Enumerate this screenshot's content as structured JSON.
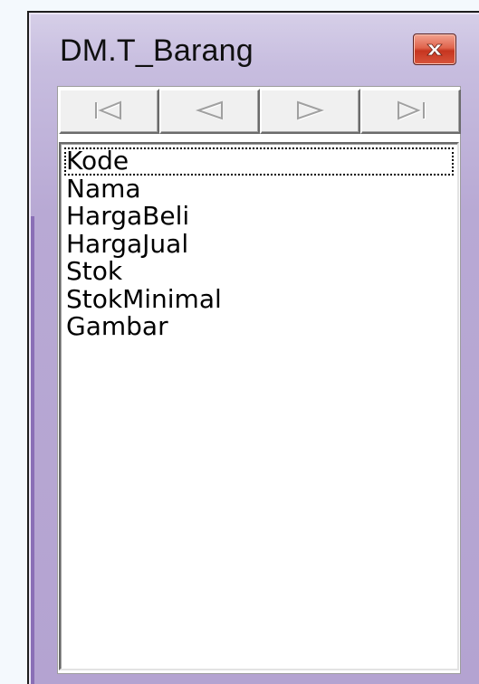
{
  "window": {
    "title": "DM.T_Barang",
    "close_icon": "close-icon"
  },
  "navigator": {
    "buttons": [
      {
        "name": "first",
        "icon": "first-record-icon"
      },
      {
        "name": "prior",
        "icon": "prior-record-icon"
      },
      {
        "name": "next",
        "icon": "next-record-icon"
      },
      {
        "name": "last",
        "icon": "last-record-icon"
      }
    ]
  },
  "fields": {
    "items": [
      "Kode",
      "Nama",
      "HargaBeli",
      "HargaJual",
      "Stok",
      "StokMinimal",
      "Gambar"
    ],
    "focused_index": 0
  },
  "colors": {
    "frame": "#c7bddf",
    "close_button": "#d8553c",
    "disabled_glyph": "#a0a0a0"
  }
}
